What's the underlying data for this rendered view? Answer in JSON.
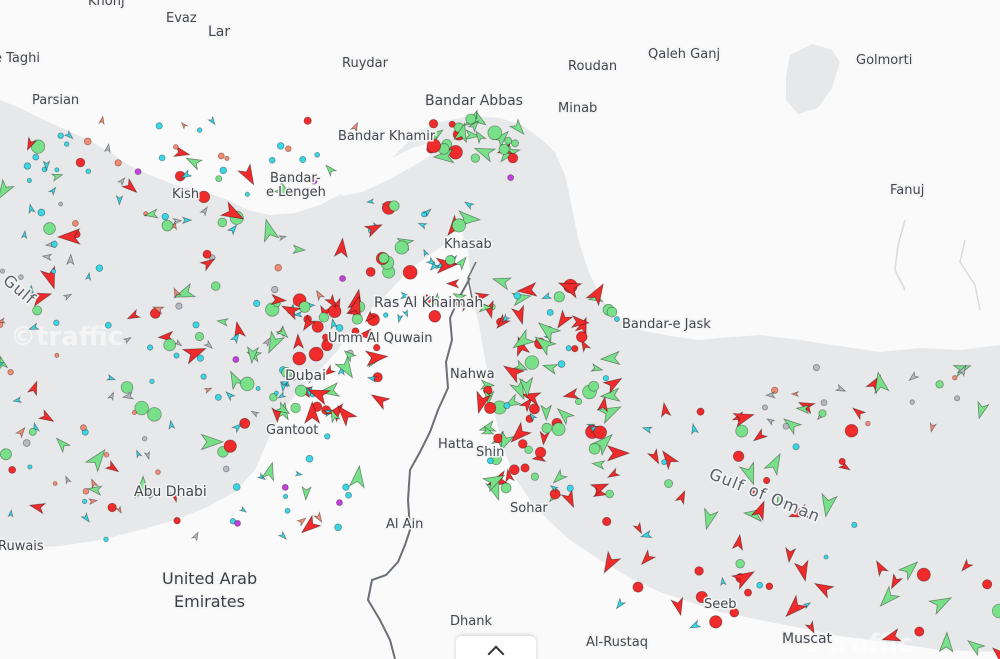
{
  "map": {
    "watermark": "©traffic",
    "watermark_right": "©traffic",
    "colors": {
      "water": "#e7e8ea",
      "land": "#fafafa",
      "border": "#6b6f76",
      "cargo": "#ef2b2b",
      "tanker": "#79e08a",
      "passenger": "#3ad6e6",
      "fishing": "#f28b73",
      "other": "#b6bac0",
      "pleasure": "#c43ee0"
    },
    "places": [
      {
        "id": "khonj",
        "label": "Khonj"
      },
      {
        "id": "evaz",
        "label": "Evaz"
      },
      {
        "id": "lar",
        "label": "Lar"
      },
      {
        "id": "taghi",
        "label": "e Taghi"
      },
      {
        "id": "parsian",
        "label": "Parsian"
      },
      {
        "id": "ruydar",
        "label": "Ruydar"
      },
      {
        "id": "roudan",
        "label": "Roudan"
      },
      {
        "id": "qaleh-ganj",
        "label": "Qaleh Ganj"
      },
      {
        "id": "golmorti",
        "label": "Golmorti"
      },
      {
        "id": "bandar-abbas",
        "label": "Bandar Abbas"
      },
      {
        "id": "minab",
        "label": "Minab"
      },
      {
        "id": "bandar-khamir",
        "label": "Bandar Khamir"
      },
      {
        "id": "bandar-lengeh-1",
        "label": "Bandar-"
      },
      {
        "id": "bandar-lengeh-2",
        "label": "e Lengeh"
      },
      {
        "id": "kish",
        "label": "Kish"
      },
      {
        "id": "fanuj",
        "label": "Fanuj"
      },
      {
        "id": "khasab",
        "label": "Khasab"
      },
      {
        "id": "ras-al-khaimah",
        "label": "Ras Al Khaimah"
      },
      {
        "id": "bandar-e-jask",
        "label": "Bandar-e Jask"
      },
      {
        "id": "umm-al-quwain",
        "label": "Umm Al Quwain"
      },
      {
        "id": "dubai",
        "label": "Dubai"
      },
      {
        "id": "nahwa",
        "label": "Nahwa"
      },
      {
        "id": "gantoot",
        "label": "Gantoot"
      },
      {
        "id": "hatta",
        "label": "Hatta"
      },
      {
        "id": "shinas",
        "label": "Shin"
      },
      {
        "id": "abu-dhabi",
        "label": "Abu Dhabi"
      },
      {
        "id": "sohar",
        "label": "Sohar"
      },
      {
        "id": "al-ain",
        "label": "Al Ain"
      },
      {
        "id": "ruwais",
        "label": "Ruwais"
      },
      {
        "id": "uae-1",
        "label": "United Arab"
      },
      {
        "id": "uae-2",
        "label": "Emirates"
      },
      {
        "id": "dhank",
        "label": "Dhank"
      },
      {
        "id": "seeb",
        "label": "Seeb"
      },
      {
        "id": "al-rustaq",
        "label": "Al-Rustaq"
      },
      {
        "id": "muscat",
        "label": "Muscat"
      },
      {
        "id": "gulf-of-oman",
        "label": "Gulf of Oman"
      },
      {
        "id": "gulf",
        "label": "Gulf"
      }
    ]
  }
}
